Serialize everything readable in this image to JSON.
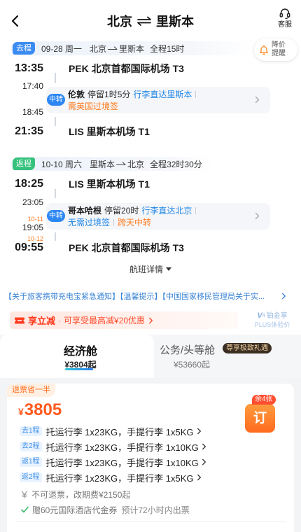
{
  "header": {
    "title_from": "北京",
    "title_to": "里斯本",
    "service_label": "客服"
  },
  "price_alert": {
    "line1": "降价",
    "line2": "提醒"
  },
  "outbound": {
    "badge": "去程",
    "date": "09-28 周一",
    "from": "北京",
    "to": "里斯本",
    "duration": "全程15时",
    "dep_time": "13:35",
    "dep_airport": "PEK 北京首都国际机场 T3",
    "transfer": {
      "badge": "中转",
      "arr_time": "17:40",
      "dep_time": "18:45",
      "city": "伦敦",
      "stay": "停留1时5分",
      "baggage": "行李直达里斯本",
      "visa": "需英国过境签"
    },
    "arr_time": "21:35",
    "arr_airport": "LIS 里斯本机场 T1"
  },
  "inbound": {
    "badge": "返程",
    "date": "10-10 周六",
    "from": "里斯本",
    "to": "北京",
    "duration": "全程32时30分",
    "dep_time": "18:25",
    "dep_airport": "LIS 里斯本机场 T1",
    "transfer": {
      "badge": "中转",
      "arr_time": "23:05",
      "dep_date": "10-11",
      "dep_time": "19:05",
      "city": "哥本哈根",
      "stay": "停留20时",
      "baggage": "行李直达北京",
      "visa": "无需过境签",
      "note": "跨天中转"
    },
    "arr_date": "10-12",
    "arr_time": "09:55",
    "arr_airport": "PEK 北京首都国际机场 T3"
  },
  "flight_details_label": "航班详情",
  "notice": "【关于旅客携带充电宝紧急通知】【温馨提示】【中国国家移民管理局关于实...",
  "promo": {
    "title": "享立减",
    "separator": "·",
    "text": "可享受最高减¥20优惠"
  },
  "plus": {
    "level_letter": "V",
    "level_number": "4",
    "line1": "铂金享",
    "line2": "PLUS体验价"
  },
  "cabins": [
    {
      "name": "经济舱",
      "price": "¥3804起",
      "active": true
    },
    {
      "name": "公务/头等舱",
      "badge": "尊享极致礼遇",
      "price": "¥53660起",
      "active": false
    }
  ],
  "fare": {
    "tag": "退票省一半",
    "currency": "¥",
    "price": "3805",
    "remaining": "余4张",
    "book_label": "订",
    "baggage": [
      {
        "segment": "去1程",
        "text": "托运行李 1x23KG，手提行李 1x5KG"
      },
      {
        "segment": "去2程",
        "text": "托运行李 1x23KG，手提行李 1x10KG"
      },
      {
        "segment": "返1程",
        "text": "托运行李 1x23KG，手提行李 1x10KG"
      },
      {
        "segment": "返2程",
        "text": "托运行李 1x23KG，手提行李 1x5KG"
      }
    ],
    "refund_policy": "不可退票，改期费¥2150起",
    "gift": "赠60元国际酒店代金券",
    "ticketing": "预计72小时内出票"
  },
  "colors": {
    "outbound_badge": "#3b8cf2",
    "inbound_badge": "#35c27c",
    "accent_blue": "#1f86e6",
    "accent_orange": "#ff7a1c",
    "price": "#ff5a1f",
    "notice": "#3b84d6",
    "book_button": "#ff7d23"
  },
  "icons": [
    "back-arrow-icon",
    "round-trip-swap-icon",
    "headset-icon",
    "bell-icon",
    "route-arrow-icon",
    "chevron-right-icon",
    "triangle-down-icon",
    "coupon-icon",
    "yen-icon",
    "check-icon"
  ]
}
